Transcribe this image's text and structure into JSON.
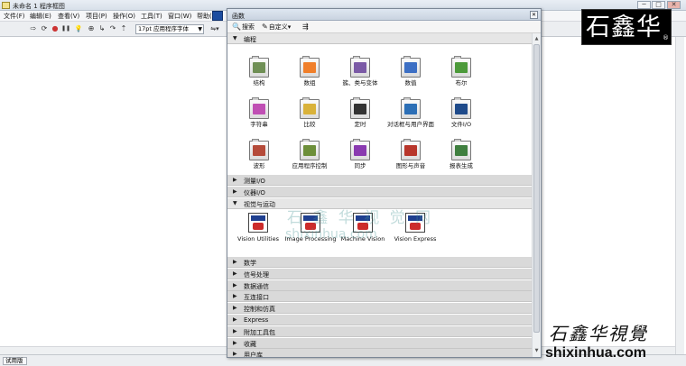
{
  "window": {
    "title": "未命名 1 程序框图",
    "controls": [
      "─",
      "□",
      "✕"
    ]
  },
  "menubar": {
    "items": [
      "文件(F)",
      "编辑(E)",
      "查看(V)",
      "项目(P)",
      "操作(O)",
      "工具(T)",
      "窗口(W)",
      "帮助(H)"
    ]
  },
  "toolbar": {
    "buttons": [
      {
        "icon": "run-arrow-icon",
        "glyph": "⇨"
      },
      {
        "icon": "run-continuously-icon",
        "glyph": "⟳"
      },
      {
        "icon": "abort-icon",
        "glyph": "●"
      },
      {
        "icon": "pause-icon",
        "glyph": "❚❚"
      },
      {
        "icon": "highlight-execution-icon",
        "glyph": "💡"
      },
      {
        "icon": "retain-wire-values-icon",
        "glyph": "⊕"
      },
      {
        "icon": "step-into-icon",
        "glyph": "↳"
      },
      {
        "icon": "step-over-icon",
        "glyph": "↷"
      },
      {
        "icon": "step-out-icon",
        "glyph": "⇡"
      }
    ],
    "font_select": "17pt 应用程序字体",
    "align_label": "⇋▾"
  },
  "statusbar": {
    "text": "试用版"
  },
  "palette": {
    "title": "函数",
    "close": "✕",
    "tools": [
      {
        "icon": "search-icon",
        "glyph": "🔍",
        "label": "搜索"
      },
      {
        "icon": "customize-icon",
        "glyph": "✎",
        "label": "自定义▾"
      },
      {
        "icon": "view-icon",
        "glyph": "⇶",
        "label": ""
      }
    ],
    "programming": {
      "header": "编程",
      "items": [
        {
          "name": "structures",
          "label": "结构",
          "color": "#6f8f55"
        },
        {
          "name": "array",
          "label": "数组",
          "color": "#f07f2a"
        },
        {
          "name": "cluster-class-variant",
          "label": "簇、类与变体",
          "color": "#7b5aa6"
        },
        {
          "name": "numeric",
          "label": "数值",
          "color": "#3c6fc4"
        },
        {
          "name": "boolean",
          "label": "布尔",
          "color": "#4c9a3a"
        },
        {
          "name": "string",
          "label": "字符串",
          "color": "#c04fb4"
        },
        {
          "name": "comparison",
          "label": "比较",
          "color": "#d9b23a"
        },
        {
          "name": "timing",
          "label": "定时",
          "color": "#333333"
        },
        {
          "name": "dialog-ui",
          "label": "对话框与用户界面",
          "color": "#2c6fb6"
        },
        {
          "name": "file-io",
          "label": "文件I/O",
          "color": "#1e4a8a"
        },
        {
          "name": "waveform",
          "label": "波形",
          "color": "#b54b3a"
        },
        {
          "name": "application-control",
          "label": "应用程序控制",
          "color": "#6d8f3a"
        },
        {
          "name": "synchronization",
          "label": "同步",
          "color": "#8a3ab0"
        },
        {
          "name": "graphics-sound",
          "label": "图形与声音",
          "color": "#b8362b"
        },
        {
          "name": "report-generation",
          "label": "报表生成",
          "color": "#3f7f3f"
        }
      ]
    },
    "collapsed_top": [
      "测量I/O",
      "仪器I/O"
    ],
    "vision": {
      "header": "视觉与运动",
      "items": [
        {
          "name": "vision-utilities",
          "label": "Vision Utilities"
        },
        {
          "name": "image-processing",
          "label": "Image Processing"
        },
        {
          "name": "machine-vision",
          "label": "Machine Vision"
        },
        {
          "name": "vision-express",
          "label": "Vision Express"
        }
      ]
    },
    "collapsed_bottom": [
      "数学",
      "信号处理",
      "数据通信",
      "互连接口",
      "控制和仿真",
      "Express",
      "附加工具包",
      "收藏",
      "用户库"
    ]
  },
  "watermarks": {
    "box_text": "石鑫华",
    "box_reg": "®",
    "center_text": "石 鑫 华 视 觉 网",
    "center_url": "shixinhua.com",
    "signature": "石鑫华視覺",
    "url": "shixinhua.com"
  }
}
